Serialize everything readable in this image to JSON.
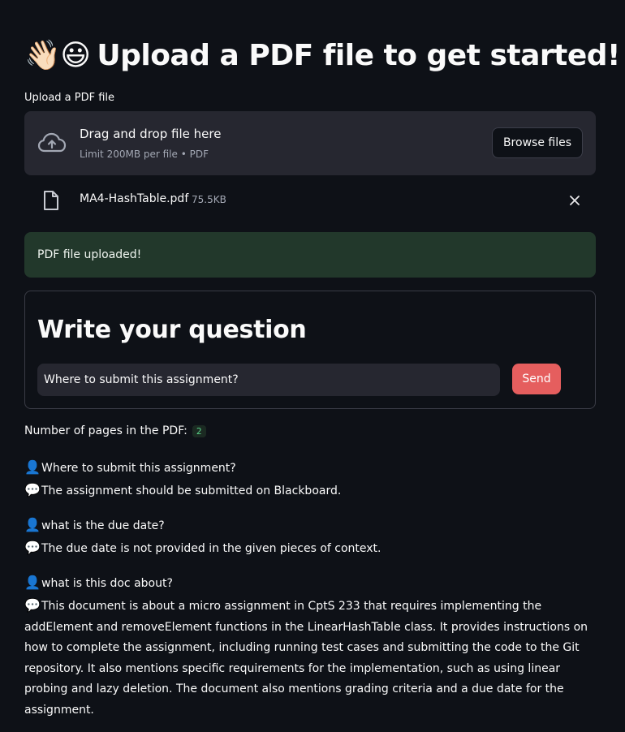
{
  "header": {
    "wave_emoji": "👋🏻",
    "smile_emoji": "😃",
    "title": "Upload a PDF file to get started!"
  },
  "uploader": {
    "label": "Upload a PDF file",
    "drop_title": "Drag and drop file here",
    "drop_subtitle": "Limit 200MB per file • PDF",
    "browse_label": "Browse files",
    "cloud_icon": "cloud-upload-icon"
  },
  "uploaded_file": {
    "name": "MA4-HashTable.pdf",
    "size": "75.5KB",
    "file_icon": "file-icon",
    "remove_icon": "close-icon"
  },
  "status": {
    "message": "PDF file uploaded!",
    "color": "#22382b"
  },
  "question_form": {
    "title": "Write your question",
    "input_value": "Where to submit this assignment?",
    "send_label": "Send",
    "send_color": "#e55e5e"
  },
  "pdf_info": {
    "pages_label": "Number of pages in the PDF:",
    "pages_value": "2"
  },
  "chat": {
    "user_emoji": "👤",
    "bot_emoji": "💬",
    "messages": [
      {
        "question": "Where to submit this assignment?",
        "answer": "The assignment should be submitted on Blackboard."
      },
      {
        "question": "what is the due date?",
        "answer": "The due date is not provided in the given pieces of context."
      },
      {
        "question": "what is this doc about?",
        "answer": "This document is about a micro assignment in CptS 233 that requires implementing the addElement and removeElement functions in the LinearHashTable class. It provides instructions on how to complete the assignment, including running test cases and submitting the code to the Git repository. It also mentions specific requirements for the implementation, such as using linear probing and lazy deletion. The document also mentions grading criteria and a due date for the assignment."
      }
    ]
  }
}
